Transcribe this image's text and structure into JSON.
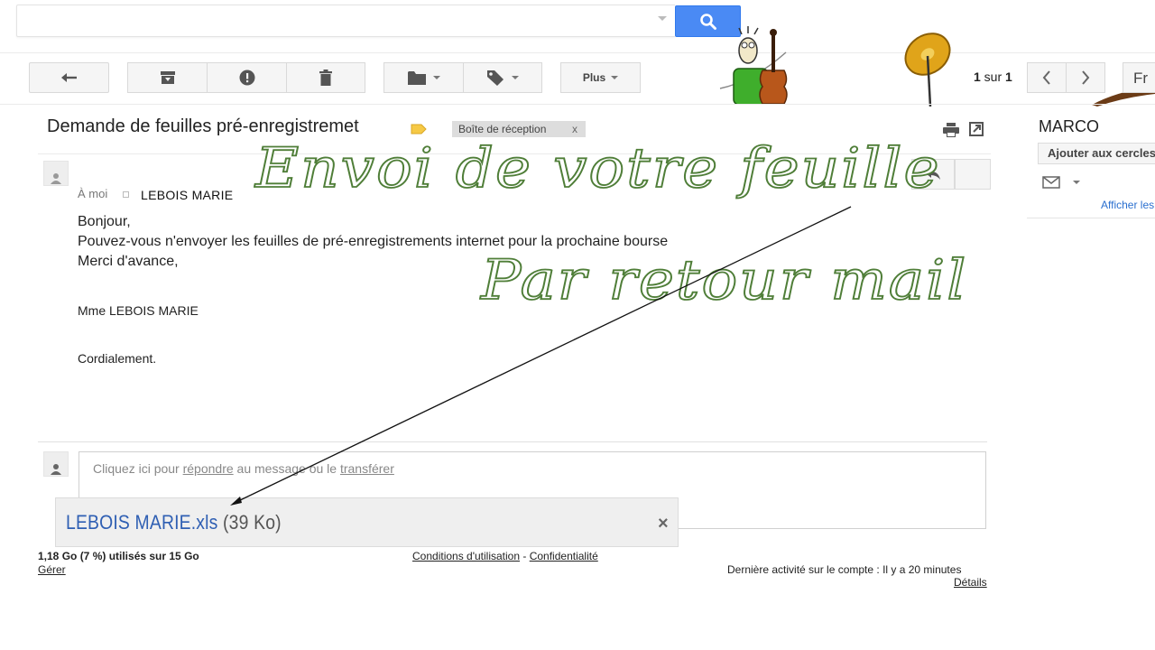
{
  "search": {
    "placeholder": "",
    "value": ""
  },
  "toolbar": {
    "plus_label": "Plus",
    "pager_current": "1",
    "pager_sep": " sur ",
    "pager_total": "1",
    "lang_label": "Fr"
  },
  "message": {
    "subject": "Demande de feuilles pré-enregistremet",
    "label_chip": "Boîte de réception",
    "label_chip_close": "x",
    "to_text": "À moi",
    "sender_overlay": "LEBOIS MARIE",
    "body": {
      "greeting": "Bonjour,",
      "line1": "Pouvez-vous n'envoyer les feuilles de pré-enregistrements internet pour la prochaine bourse",
      "line2": "Merci d'avance,",
      "signature": "Mme LEBOIS MARIE",
      "closing": "Cordialement."
    }
  },
  "reply": {
    "prefix": "Cliquez ici pour ",
    "reply_link": "répondre",
    "middle": " au message ou le ",
    "forward_link": "transférer"
  },
  "attachment": {
    "name": "LEBOIS MARIE.xls",
    "size": "(39 Ko)",
    "close": "×"
  },
  "footer": {
    "storage": "1,18 Go (7 %) utilisés sur 15 Go",
    "manage": "Gérer",
    "terms": "Conditions d'utilisation",
    "dash": " - ",
    "privacy": "Confidentialité",
    "activity": "Dernière activité sur le compte : Il y a 20 minutes",
    "details": "Détails"
  },
  "profile": {
    "name": "MARCO",
    "add_circles": "Ajouter aux cercles",
    "show_link": "Afficher les détails"
  },
  "overlay": {
    "line1": "Envoi de votre feuille",
    "line2": "Par retour mail",
    "color": "#4f7e38"
  },
  "colors": {
    "search_button": "#4a8af4",
    "label_tag": "#f6c945",
    "link_blue": "#2f5fb3"
  }
}
